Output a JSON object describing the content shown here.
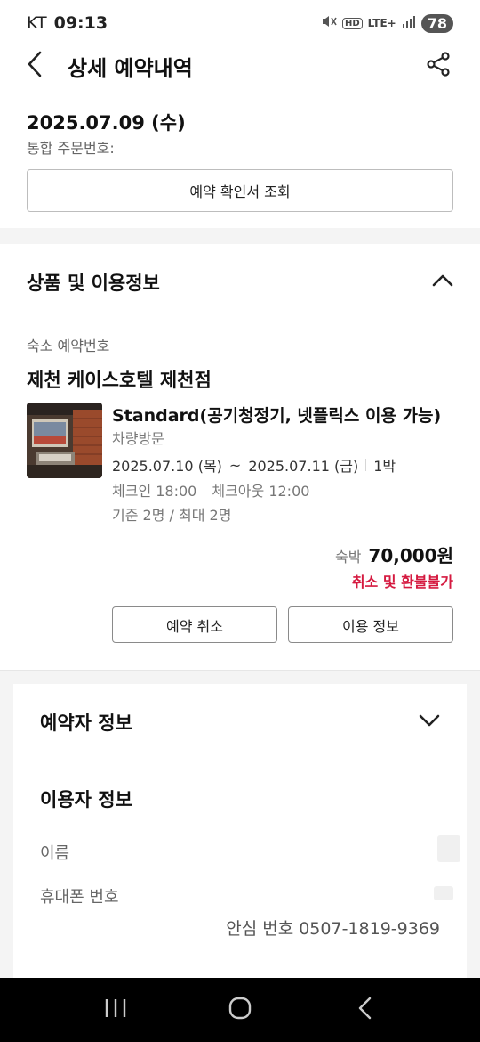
{
  "status_bar": {
    "carrier": "KT",
    "time": "09:13",
    "network": "LTE+",
    "hd": "HD",
    "battery": "78"
  },
  "header": {
    "title": "상세 예약내역",
    "back_icon": "chevron-left-icon",
    "share_icon": "share-icon"
  },
  "order": {
    "date": "2025.07.09 (수)",
    "order_number_label": "통합 주문번호:",
    "confirm_button": "예약 확인서 조회"
  },
  "product_section": {
    "title": "상품 및 이용정보",
    "stay_reservation_label": "숙소 예약번호",
    "hotel_name": "제천 케이스호텔 제천점",
    "room_name": "Standard(공기청정기, 넷플릭스 이용 가능)",
    "visit_type": "차량방문",
    "check_in_date": "2025.07.10 (목)",
    "date_separator": "~",
    "check_out_date": "2025.07.11 (금)",
    "nights": "1박",
    "check_in_time": "체크인 18:00",
    "check_out_time": "체크아웃 12:00",
    "occupancy": "기준 2명 / 최대 2명",
    "price_label": "숙박",
    "price": "70,000원",
    "refund_note": "취소 및 환불불가",
    "cancel_button": "예약 취소",
    "info_button": "이용 정보"
  },
  "reserver_section": {
    "title": "예약자 정보"
  },
  "user_section": {
    "title": "이용자 정보",
    "name_label": "이름",
    "phone_label": "휴대폰 번호",
    "safe_number": "안심 번호 0507-1819-9369"
  },
  "colors": {
    "accent_red": "#d51a40",
    "divider_gray": "#f4f4f4",
    "text_primary": "#111111",
    "text_secondary": "#777777"
  }
}
